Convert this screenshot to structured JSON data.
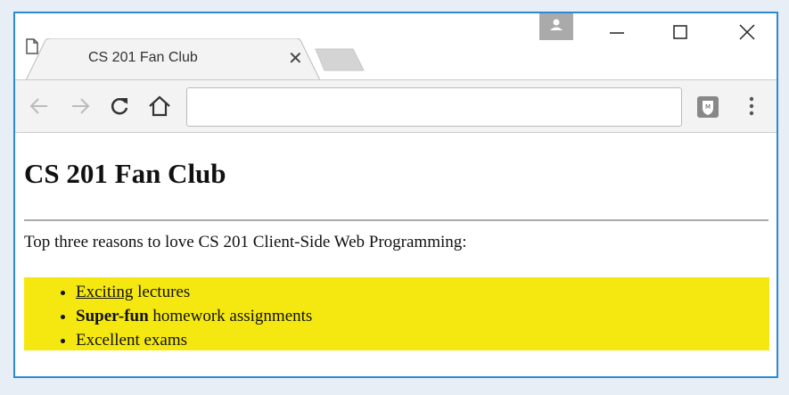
{
  "browser": {
    "tab_title": "CS 201 Fan Club",
    "tab_icon": "page-icon",
    "address_value": "",
    "colors": {
      "frame": "#2b8ad3",
      "highlight": "#f5e811"
    }
  },
  "page": {
    "heading": "CS 201 Fan Club",
    "intro": "Top three reasons to love CS 201 Client-Side Web Programming:",
    "items": [
      {
        "link": "Exciting",
        "rest": " lectures"
      },
      {
        "bold": "Super-fun",
        "rest": " homework assignments"
      },
      {
        "text": "Excellent exams"
      }
    ]
  }
}
